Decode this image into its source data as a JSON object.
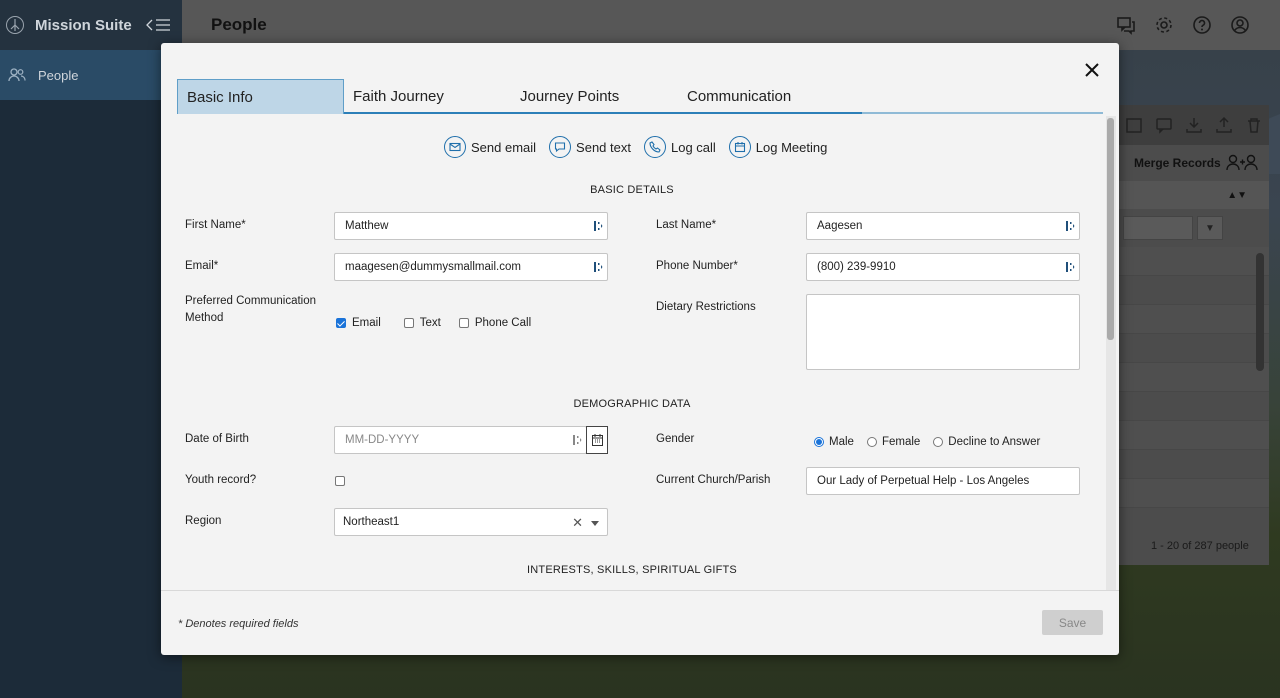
{
  "app": {
    "name": "Mission Suite",
    "nav_people": "People",
    "page_title": "People"
  },
  "background": {
    "merge_records": "Merge Records",
    "pagination": "1 - 20 of 287 people"
  },
  "modal": {
    "tabs": [
      {
        "label": "Basic Info",
        "active": true
      },
      {
        "label": "Faith Journey",
        "active": false
      },
      {
        "label": "Journey Points",
        "active": false
      },
      {
        "label": "Communication",
        "active": false
      }
    ],
    "actions": {
      "send_email": "Send email",
      "send_text": "Send text",
      "log_call": "Log call",
      "log_meeting": "Log Meeting"
    },
    "sections": {
      "basic": "BASIC DETAILS",
      "demographic": "DEMOGRAPHIC DATA",
      "interests": "INTERESTS, SKILLS, SPIRITUAL GIFTS"
    },
    "fields": {
      "first_name_label": "First Name*",
      "first_name": "Matthew",
      "last_name_label": "Last Name*",
      "last_name": "Aagesen",
      "email_label": "Email*",
      "email": "maagesen@dummysmallmail.com",
      "phone_label": "Phone Number*",
      "phone": "(800) 239-9910",
      "pref_comm_label": "Preferred Communication Method",
      "pref_options": [
        {
          "label": "Email",
          "checked": true
        },
        {
          "label": "Text",
          "checked": false
        },
        {
          "label": "Phone Call",
          "checked": false
        }
      ],
      "dietary_label": "Dietary Restrictions",
      "dob_label": "Date of Birth",
      "dob_placeholder": "MM-DD-YYYY",
      "gender_label": "Gender",
      "gender_options": [
        {
          "label": "Male",
          "selected": true
        },
        {
          "label": "Female",
          "selected": false
        },
        {
          "label": "Decline to Answer",
          "selected": false
        }
      ],
      "youth_label": "Youth record?",
      "youth_checked": false,
      "church_label": "Current Church/Parish",
      "church": "Our Lady of Perpetual Help - Los Angeles",
      "region_label": "Region",
      "region": "Northeast1"
    },
    "footer": {
      "required_note": "* Denotes required fields",
      "save_label": "Save"
    }
  },
  "colors": {
    "accent": "#1f6fab",
    "active_tab_bg": "#bed6e7",
    "checkbox_blue": "#1a73d9"
  }
}
